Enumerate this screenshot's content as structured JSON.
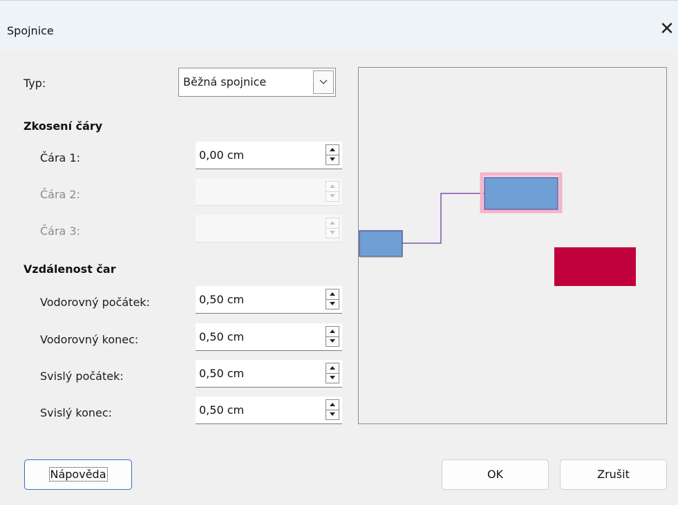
{
  "dialog": {
    "title": "Spojnice"
  },
  "type": {
    "label": "Typ:",
    "value": "Běžná spojnice"
  },
  "skew": {
    "heading": "Zkosení čáry",
    "rows": [
      {
        "label": "Čára 1:",
        "value": "0,00 cm",
        "enabled": true
      },
      {
        "label": "Čára 2:",
        "value": "",
        "enabled": false
      },
      {
        "label": "Čára 3:",
        "value": "",
        "enabled": false
      }
    ]
  },
  "spacing": {
    "heading": "Vzdálenost čar",
    "rows": [
      {
        "label": "Vodorovný počátek:",
        "value": "0,50 cm"
      },
      {
        "label": "Vodorovný konec:",
        "value": "0,50 cm"
      },
      {
        "label": "Svislý počátek:",
        "value": "0,50 cm"
      },
      {
        "label": "Svislý konec:",
        "value": "0,50 cm"
      }
    ]
  },
  "buttons": {
    "help": "Nápověda",
    "ok": "OK",
    "cancel": "Zrušit"
  },
  "colors": {
    "shape_fill": "#6f9fd5",
    "shape_border": "#7b5fa8",
    "accent_rect": "#c0003c",
    "connector": "#7d52b0"
  }
}
